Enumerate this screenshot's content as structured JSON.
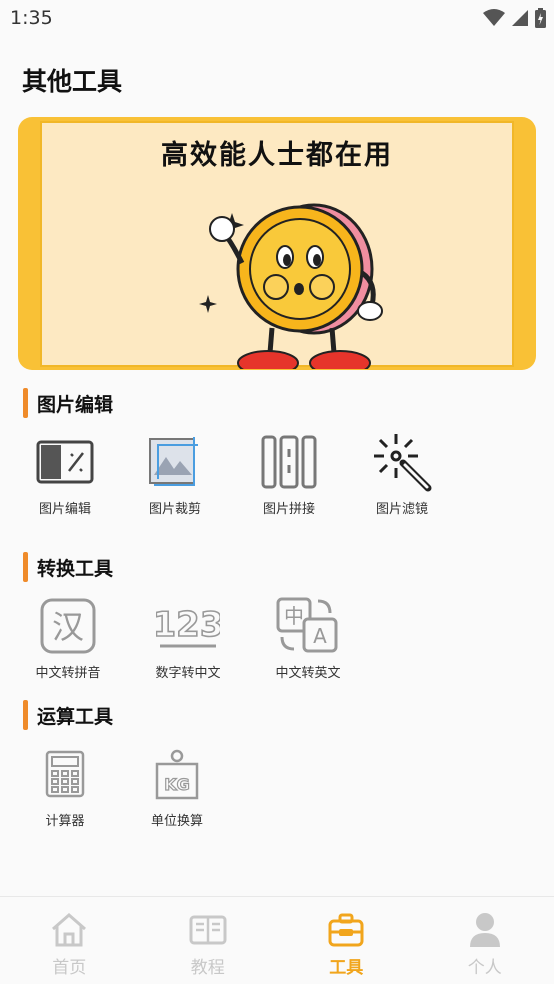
{
  "status_bar": {
    "time": "1:35"
  },
  "page": {
    "title": "其他工具"
  },
  "banner": {
    "headline": "高效能人士都在用"
  },
  "sections": [
    {
      "title": "图片编辑",
      "tools": [
        {
          "label": "图片编辑",
          "icon": "image-edit-icon"
        },
        {
          "label": "图片裁剪",
          "icon": "image-crop-icon"
        },
        {
          "label": "图片拼接",
          "icon": "image-stitch-icon"
        },
        {
          "label": "图片滤镜",
          "icon": "magic-wand-icon"
        }
      ]
    },
    {
      "title": "转换工具",
      "tools": [
        {
          "label": "中文转拼音",
          "icon": "chinese-char-icon",
          "glyph": "汉"
        },
        {
          "label": "数字转中文",
          "icon": "numbers-icon",
          "glyph": "123"
        },
        {
          "label": "中文转英文",
          "icon": "translate-icon",
          "glyph_a": "中",
          "glyph_b": "A"
        }
      ]
    },
    {
      "title": "运算工具",
      "tools": [
        {
          "label": "计算器",
          "icon": "calculator-icon"
        },
        {
          "label": "单位换算",
          "icon": "weight-kg-icon",
          "glyph": "KG"
        }
      ]
    }
  ],
  "bottom_nav": [
    {
      "label": "首页",
      "icon": "home-icon",
      "active": false
    },
    {
      "label": "教程",
      "icon": "book-icon",
      "active": false
    },
    {
      "label": "工具",
      "icon": "toolbox-icon",
      "active": true
    },
    {
      "label": "个人",
      "icon": "person-icon",
      "active": false
    }
  ],
  "colors": {
    "accent": "#f1a51c",
    "section_bar": "#ef8b2a",
    "banner": "#f9c136",
    "inactive": "#c8c8c8"
  }
}
